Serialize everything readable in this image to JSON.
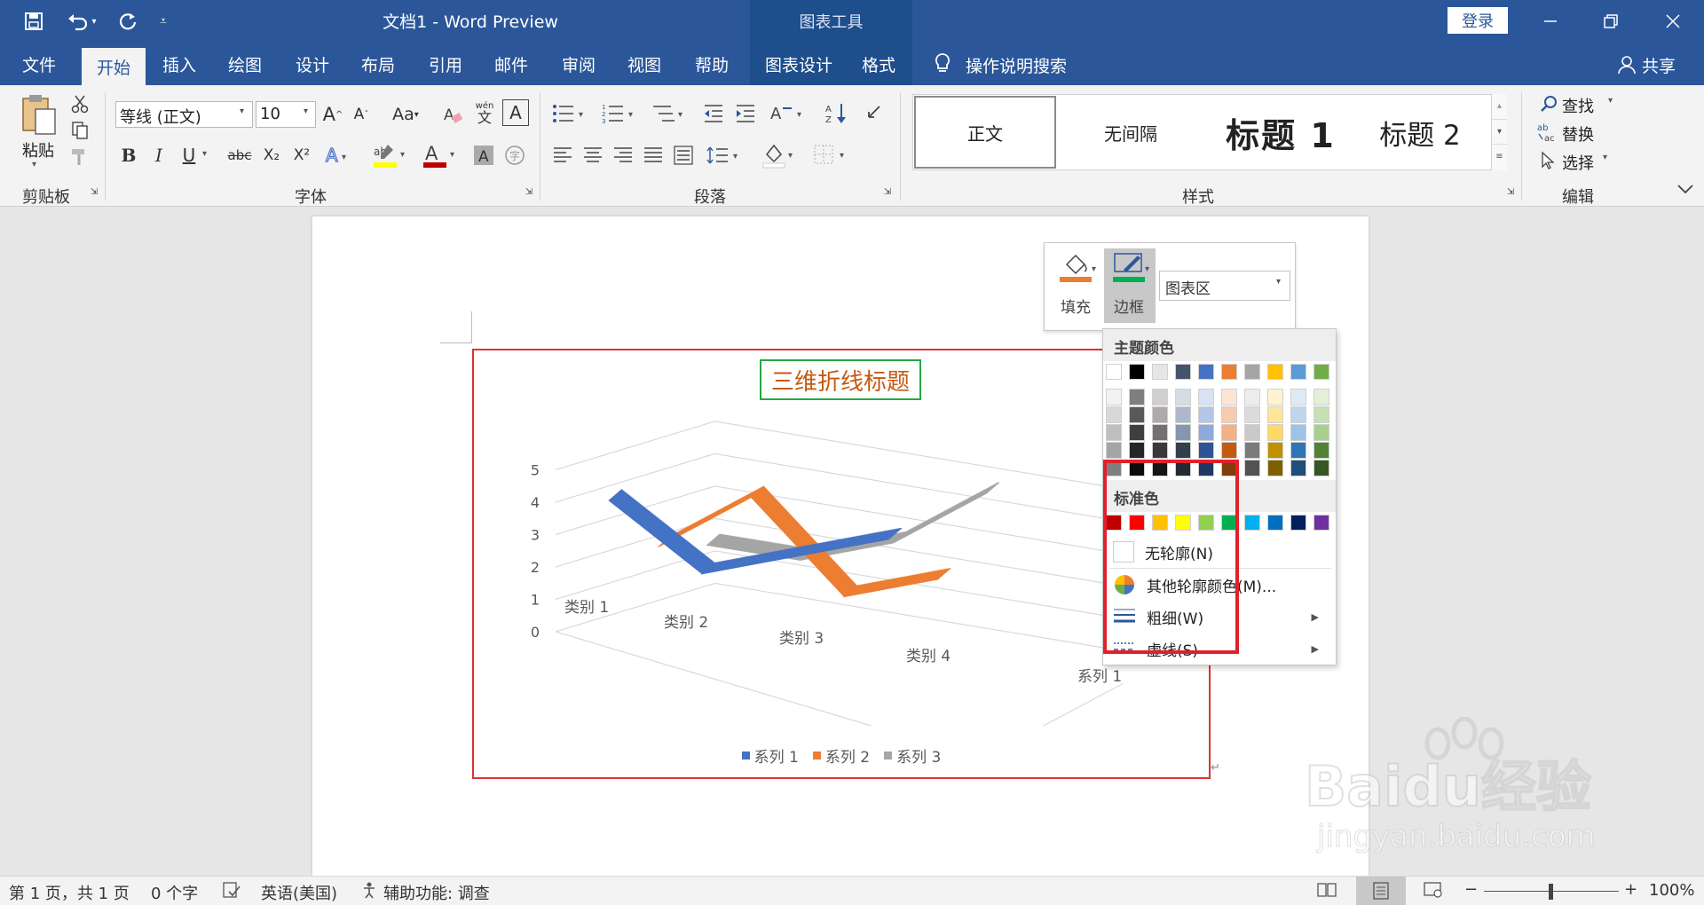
{
  "app": {
    "title": "文档1  -  Word Preview",
    "context_tools_label": "图表工具",
    "login_label": "登录",
    "share_label": "共享"
  },
  "menu": {
    "tabs": [
      "文件",
      "开始",
      "插入",
      "绘图",
      "设计",
      "布局",
      "引用",
      "邮件",
      "审阅",
      "视图",
      "帮助",
      "图表设计",
      "格式"
    ],
    "active": "开始",
    "search_label": "操作说明搜索"
  },
  "ribbon": {
    "paste_label": "粘贴",
    "clipboard_label": "剪贴板",
    "font_label": "字体",
    "paragraph_label": "段落",
    "styles_label": "样式",
    "editing_label": "编辑",
    "font_name": "等线 (正文)",
    "font_size": "10",
    "styles": [
      "正文",
      "无间隔",
      "标题 1",
      "标题 2"
    ],
    "find_label": "查找",
    "replace_label": "替换",
    "select_label": "选择",
    "bold": "B",
    "italic": "I",
    "underline": "U",
    "strike": "abc",
    "sub": "X₂",
    "sup": "X²",
    "grow": "A",
    "shrink": "A",
    "case": "Aa",
    "phonetic": "wén",
    "phonetic2": "文"
  },
  "floating_toolbar": {
    "fill_label": "填充",
    "border_label": "边框",
    "element_select": "图表区"
  },
  "dropdown": {
    "theme_colors_label": "主题颜色",
    "standard_colors_label": "标准色",
    "theme_top": [
      "#ffffff",
      "#000000",
      "#e7e6e6",
      "#44546a",
      "#4472c4",
      "#ed7d31",
      "#a5a5a5",
      "#ffc000",
      "#5b9bd5",
      "#70ad47"
    ],
    "theme_shades": [
      [
        "#f2f2f2",
        "#7f7f7f",
        "#d0cece",
        "#d6dce4",
        "#d9e2f3",
        "#fbe5d5",
        "#ededed",
        "#fff2cc",
        "#deebf6",
        "#e2efd9"
      ],
      [
        "#d8d8d8",
        "#595959",
        "#aeaaaa",
        "#adb9ca",
        "#b4c6e7",
        "#f7cbac",
        "#dbdbdb",
        "#fee599",
        "#bdd7ee",
        "#c5e0b3"
      ],
      [
        "#bfbfbf",
        "#3f3f3f",
        "#757070",
        "#8496b0",
        "#8eaadb",
        "#f4b183",
        "#c9c9c9",
        "#ffd965",
        "#9dc3e6",
        "#a8d08d"
      ],
      [
        "#a5a5a5",
        "#262626",
        "#3a3838",
        "#323f4f",
        "#2f5496",
        "#c55a11",
        "#7b7b7b",
        "#bf9000",
        "#2e75b5",
        "#538135"
      ],
      [
        "#7f7f7f",
        "#0c0c0c",
        "#171616",
        "#222a35",
        "#1f3864",
        "#833c0b",
        "#525252",
        "#7f6000",
        "#1f4e79",
        "#375623"
      ]
    ],
    "standard": [
      "#c00000",
      "#ff0000",
      "#ffc000",
      "#ffff00",
      "#92d050",
      "#00b050",
      "#00b0f0",
      "#0070c0",
      "#002060",
      "#7030a0"
    ],
    "no_outline": "无轮廓(N)",
    "more_colors": "其他轮廓颜色(M)...",
    "weight": "粗细(W)",
    "dashes": "虚线(S)"
  },
  "chart_data": {
    "type": "line",
    "title": "三维折线标题",
    "categories": [
      "类别 1",
      "类别 2",
      "类别 3",
      "类别 4"
    ],
    "y_ticks": [
      "0",
      "1",
      "2",
      "3",
      "4",
      "5"
    ],
    "ylim": [
      0,
      5
    ],
    "depth_label": "系列 1",
    "series": [
      {
        "name": "系列 1",
        "values": [
          4.3,
          2.5,
          3.5,
          4.5
        ],
        "color": "#4472c4"
      },
      {
        "name": "系列 2",
        "values": [
          2.4,
          4.4,
          1.8,
          2.8
        ],
        "color": "#ed7d31"
      },
      {
        "name": "系列 3",
        "values": [
          2.0,
          2.0,
          3.0,
          5.0
        ],
        "color": "#a5a5a5"
      }
    ],
    "legend": "bottom"
  },
  "status": {
    "page": "第 1 页，共 1 页",
    "words": "0 个字",
    "language": "英语(美国)",
    "accessibility": "辅助功能: 调查",
    "zoom": "100%"
  },
  "watermark": {
    "brand": "Baidu经验",
    "url": "jingyan.baidu.com"
  }
}
